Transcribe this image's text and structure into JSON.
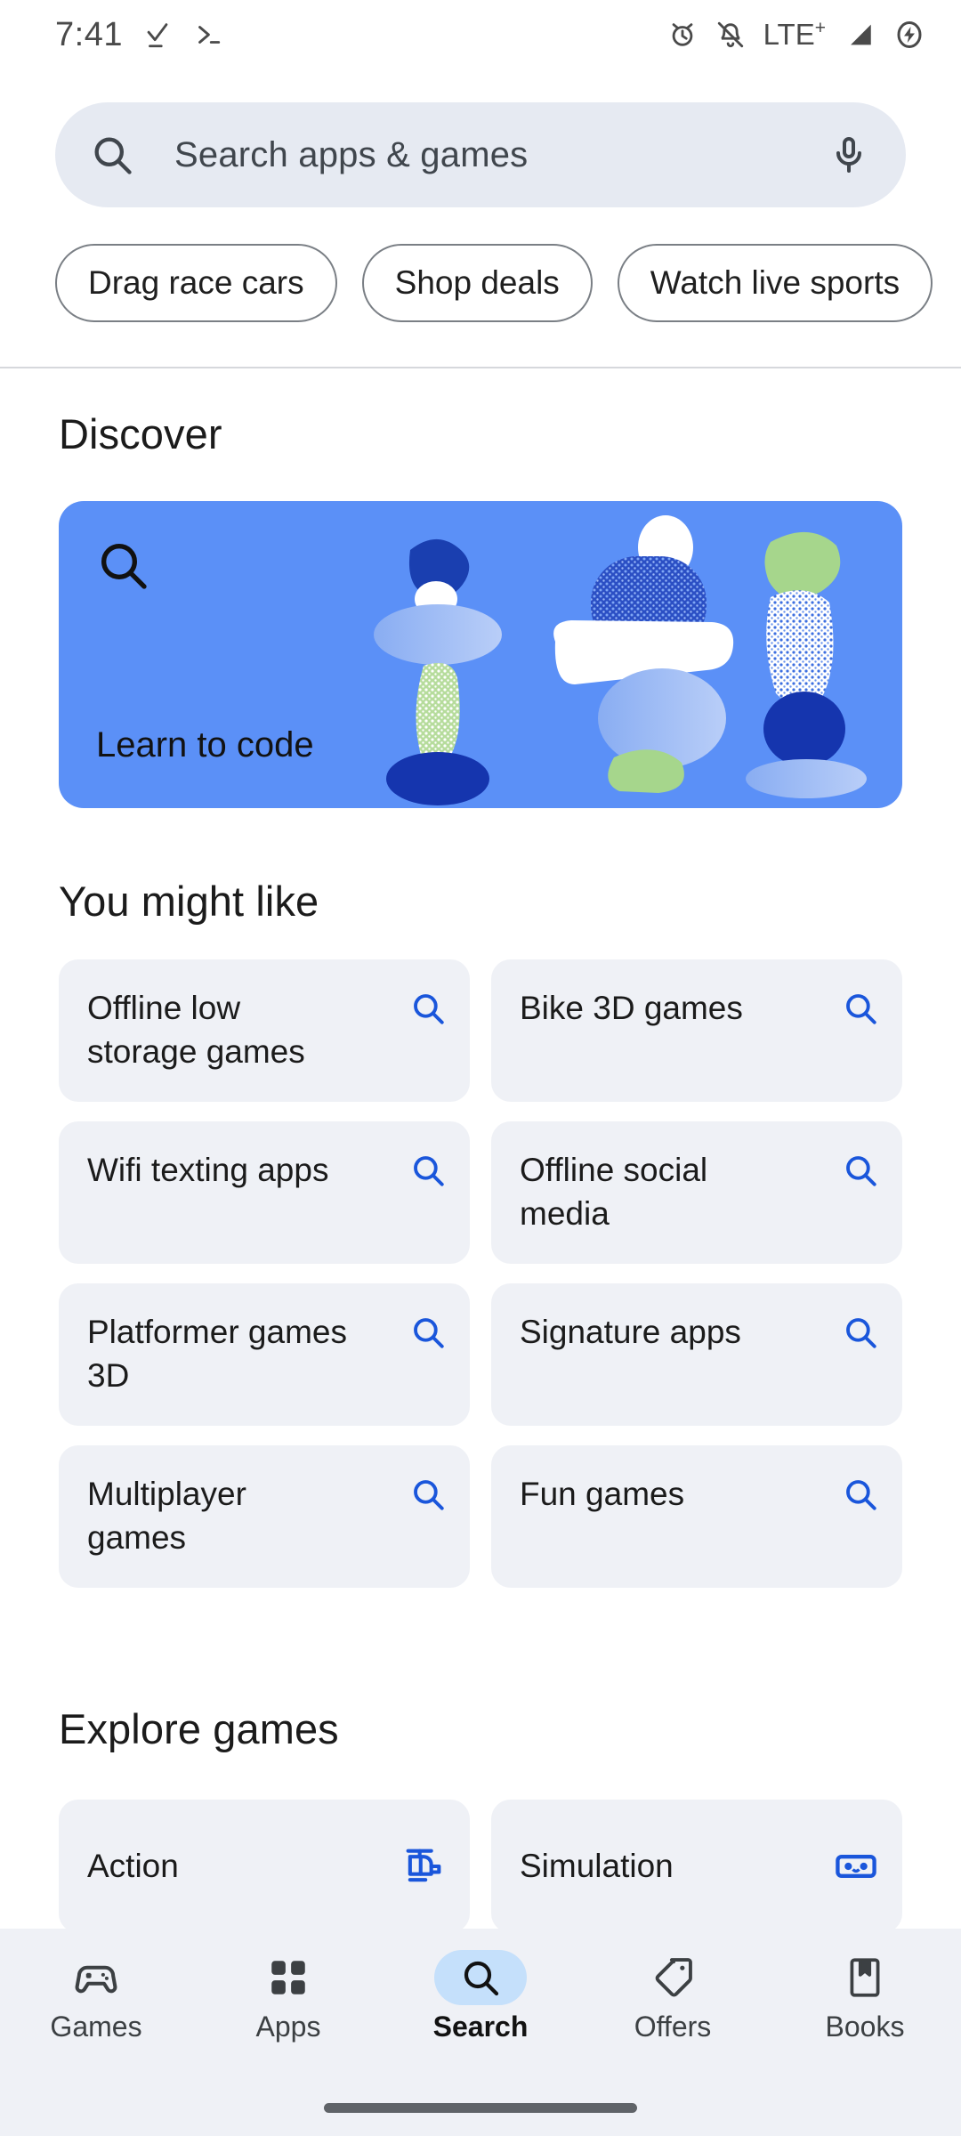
{
  "status_bar": {
    "time": "7:41",
    "left_icons": [
      "download-check-icon",
      "terminal-prompt-icon"
    ],
    "right_icons": [
      "alarm-icon",
      "notifications-muted-icon",
      "signal-icon",
      "battery-charging-icon"
    ],
    "network": "LTE",
    "network_sup": "+"
  },
  "search": {
    "placeholder": "Search apps & games",
    "search_icon": "search-icon",
    "mic_icon": "microphone-icon"
  },
  "chips": [
    {
      "label": "Drag race cars"
    },
    {
      "label": "Shop deals"
    },
    {
      "label": "Watch live sports"
    }
  ],
  "discover": {
    "heading": "Discover",
    "banner": {
      "label": "Learn to code",
      "icon": "search-icon",
      "background_color": "#5B90F7"
    }
  },
  "you_might_like": {
    "heading": "You might like",
    "items": [
      {
        "label": "Offline low storage games",
        "icon": "search-icon"
      },
      {
        "label": "Bike 3D games",
        "icon": "search-icon"
      },
      {
        "label": "Wifi texting apps",
        "icon": "search-icon"
      },
      {
        "label": "Offline social media",
        "icon": "search-icon"
      },
      {
        "label": "Platformer games 3D",
        "icon": "search-icon"
      },
      {
        "label": "Signature apps",
        "icon": "search-icon"
      },
      {
        "label": "Multiplayer games",
        "icon": "search-icon"
      },
      {
        "label": "Fun games",
        "icon": "search-icon"
      }
    ]
  },
  "explore_games": {
    "heading": "Explore games",
    "items": [
      {
        "label": "Action",
        "icon": "helicopter-icon"
      },
      {
        "label": "Simulation",
        "icon": "vr-goggles-icon"
      }
    ]
  },
  "bottom_nav": {
    "items": [
      {
        "label": "Games",
        "icon": "gamepad-icon",
        "active": false
      },
      {
        "label": "Apps",
        "icon": "grid-apps-icon",
        "active": false
      },
      {
        "label": "Search",
        "icon": "search-icon",
        "active": true
      },
      {
        "label": "Offers",
        "icon": "tag-icon",
        "active": false
      },
      {
        "label": "Books",
        "icon": "book-icon",
        "active": false
      }
    ]
  },
  "colors": {
    "accent_blue": "#1A56DB",
    "banner_blue": "#5B90F7",
    "card_grey": "#EFF1F6",
    "search_field": "#E6EAF2",
    "active_pill": "#C5E0FB"
  }
}
